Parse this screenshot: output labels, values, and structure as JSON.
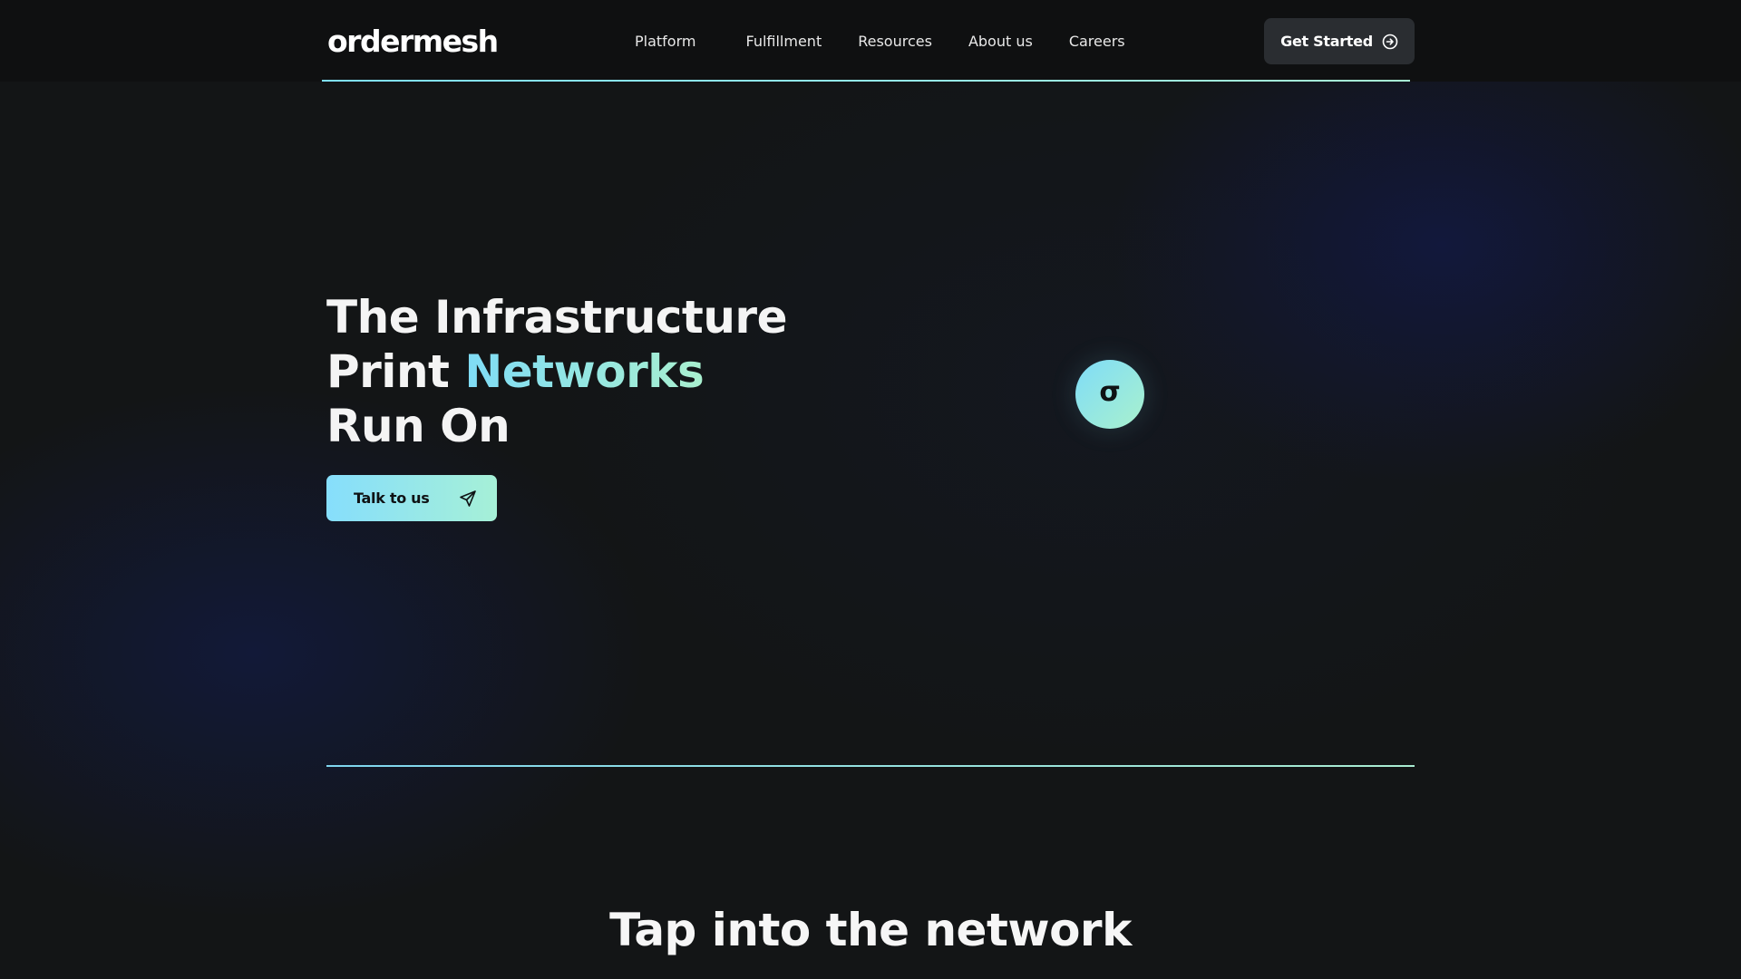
{
  "brand": {
    "logo_text": "ordermesh"
  },
  "nav": {
    "links": [
      "Platform",
      "Fulfillment",
      "Resources",
      "About us",
      "Careers"
    ],
    "cta_label": "Get Started",
    "cta_icon": "circle-arrow-right-icon"
  },
  "hero": {
    "title_line1": "The Infrastructure",
    "title_line2_prefix": "Print",
    "title_line2_highlight": "Networks",
    "title_line3": "Run On",
    "cta_label": "Talk to us",
    "cta_icon": "send-icon",
    "badge_glyph": "σ"
  },
  "section": {
    "title": "Tap into the network"
  },
  "colors": {
    "background": "#131516",
    "nav_background": "#0f1011",
    "accent_start": "#7fdcf6",
    "accent_end": "#a9f0cf",
    "button_dark": "#2a2d31"
  }
}
